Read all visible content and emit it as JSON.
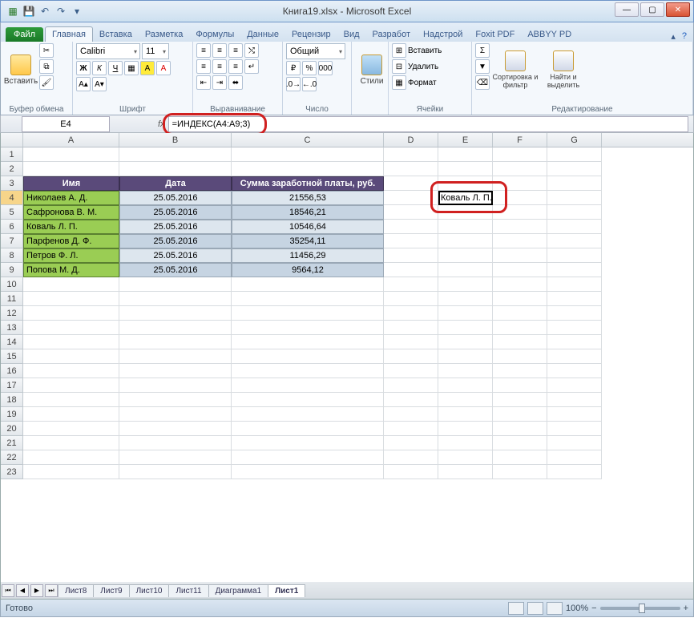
{
  "window": {
    "title": "Книга19.xlsx - Microsoft Excel"
  },
  "qat": {
    "save": "💾",
    "undo": "↶",
    "redo": "↷"
  },
  "tabs": {
    "file": "Файл",
    "home": "Главная",
    "insert": "Вставка",
    "layout": "Разметка",
    "formulas": "Формулы",
    "data": "Данные",
    "review": "Рецензир",
    "view": "Вид",
    "developer": "Разработ",
    "addins": "Надстрой",
    "foxit": "Foxit PDF",
    "abbyy": "ABBYY PD"
  },
  "ribbon": {
    "clipboard": {
      "paste": "Вставить",
      "label": "Буфер обмена"
    },
    "font": {
      "name": "Calibri",
      "size": "11",
      "label": "Шрифт"
    },
    "alignment": {
      "label": "Выравнивание"
    },
    "number": {
      "format": "Общий",
      "label": "Число"
    },
    "styles": {
      "btn": "Стили"
    },
    "cells": {
      "insert": "Вставить",
      "delete": "Удалить",
      "format": "Формат",
      "label": "Ячейки"
    },
    "editing": {
      "sort": "Сортировка и фильтр",
      "find": "Найти и выделить",
      "label": "Редактирование"
    }
  },
  "namebox": "E4",
  "formula": "=ИНДЕКС(A4:A9;3)",
  "columns": [
    "A",
    "B",
    "C",
    "D",
    "E",
    "F",
    "G"
  ],
  "table": {
    "headers": {
      "name": "Имя",
      "date": "Дата",
      "sum": "Сумма заработной платы, руб."
    },
    "rows": [
      {
        "name": "Николаев А. Д.",
        "date": "25.05.2016",
        "sum": "21556,53"
      },
      {
        "name": "Сафронова В. М.",
        "date": "25.05.2016",
        "sum": "18546,21"
      },
      {
        "name": "Коваль Л. П.",
        "date": "25.05.2016",
        "sum": "10546,64"
      },
      {
        "name": "Парфенов Д. Ф.",
        "date": "25.05.2016",
        "sum": "35254,11"
      },
      {
        "name": "Петров Ф. Л.",
        "date": "25.05.2016",
        "sum": "11456,29"
      },
      {
        "name": "Попова М. Д.",
        "date": "25.05.2016",
        "sum": "9564,12"
      }
    ]
  },
  "active_cell_value": "Коваль Л. П.",
  "sheets": {
    "nav": [
      "⏮",
      "◀",
      "▶",
      "⏭"
    ],
    "tabs": [
      "Лист8",
      "Лист9",
      "Лист10",
      "Лист11",
      "Диаграмма1",
      "Лист1"
    ]
  },
  "status": {
    "ready": "Готово",
    "zoom": "100%"
  }
}
